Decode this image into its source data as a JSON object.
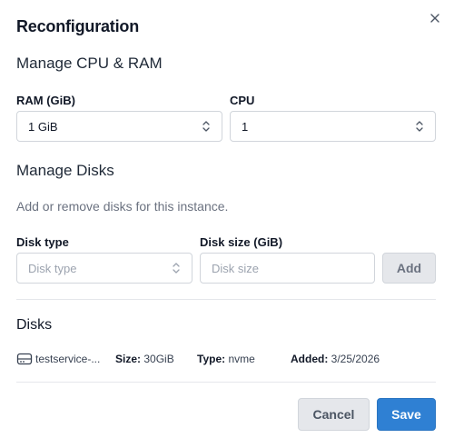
{
  "dialog": {
    "title": "Reconfiguration",
    "close_icon": "close-icon"
  },
  "cpu_ram": {
    "heading": "Manage CPU & RAM",
    "ram_label": "RAM (GiB)",
    "ram_value": "1 GiB",
    "cpu_label": "CPU",
    "cpu_value": "1"
  },
  "disks_manage": {
    "heading": "Manage Disks",
    "description": "Add or remove disks for this instance.",
    "disk_type_label": "Disk type",
    "disk_type_placeholder": "Disk type",
    "disk_size_label": "Disk size (GiB)",
    "disk_size_placeholder": "Disk size",
    "add_label": "Add"
  },
  "disks": {
    "heading": "Disks",
    "items": [
      {
        "icon": "hard-drive-icon",
        "name": "testservice-...",
        "size_label": "Size:",
        "size_value": "30GiB",
        "type_label": "Type:",
        "type_value": "nvme",
        "added_label": "Added:",
        "added_value": "3/25/2026"
      }
    ]
  },
  "footer": {
    "cancel_label": "Cancel",
    "save_label": "Save"
  },
  "colors": {
    "primary": "#2f80d3",
    "muted_button": "#e5e7eb",
    "border": "#d1d5db"
  }
}
